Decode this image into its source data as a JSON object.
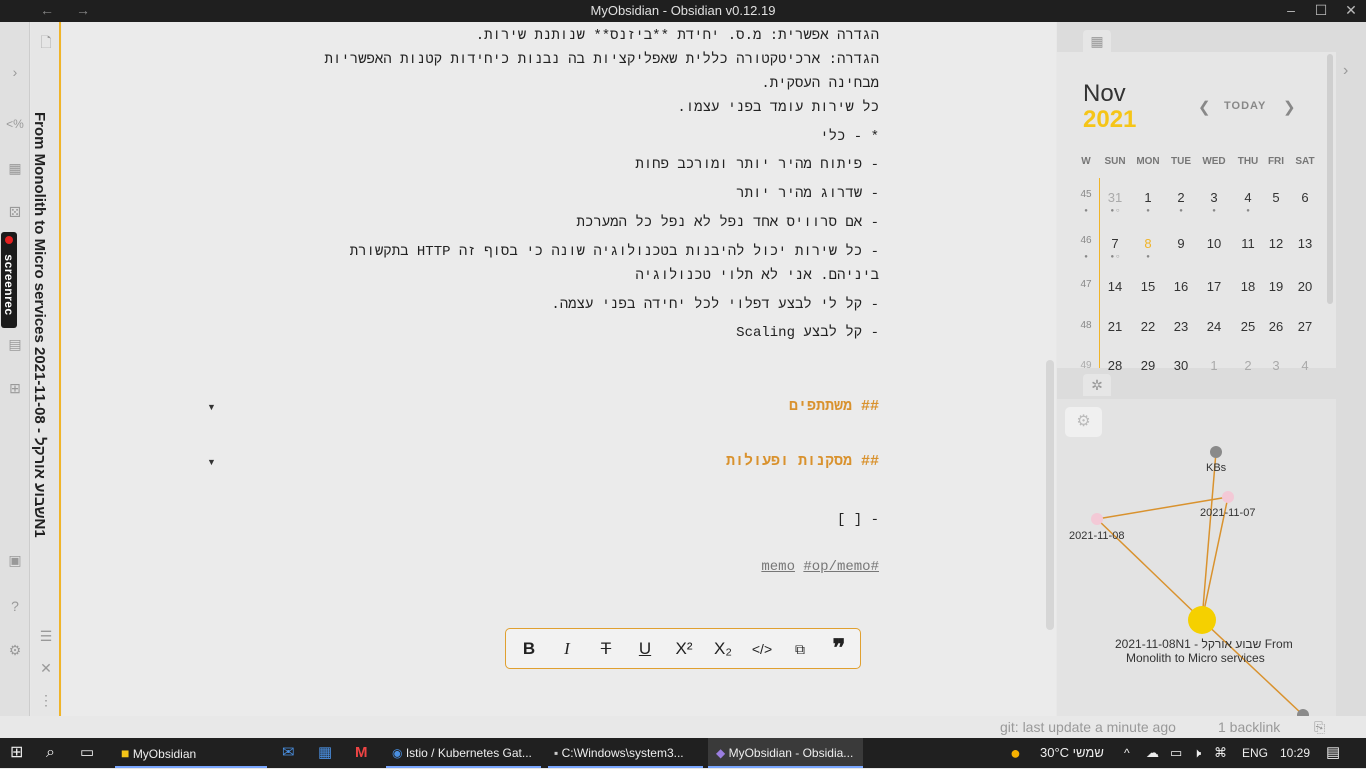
{
  "window": {
    "title": "MyObsidian - Obsidian v0.12.19"
  },
  "note": {
    "vertical_title": "From Monolith to Micro services שבוע אורקל - 2021-11-08N1"
  },
  "editor": {
    "lines": [
      "הגדרה אפשרית: מ.ס. יחידת **ביזנס** שנותנת שירות.",
      "הגדרה: ארכיטקטורה כללית שאפליקציות בה נבנות כיחידות קטנות האפשריות",
      "מבחינה העסקית.",
      "כל שירות עומד בפני עצמו.",
      "*  -  כלי",
      "- פיתוח מהיר יותר ומורכב פחות",
      "- שדרוג מהיר יותר",
      "- אם סרוויס אחד נפל לא נפל כל המערכת",
      "- כל שירות יכול להיבנות בטכנולוגיה שונה כי בסוף זה HTTP בתקשורת",
      "ביניהם. אני לא תלוי טכנולוגיה",
      "- קל לי לבצע דפלוי לכל יחידה בפני עצמה.",
      "- קל לבצע Scaling"
    ],
    "heading1": "## משתתפים",
    "heading2": "## מסקנות ופעולות",
    "checkbox": "- [ ]",
    "tag_memo": "memo",
    "tag_op": "#op/memo#"
  },
  "format_toolbar": [
    "bold",
    "italic",
    "strikethrough",
    "underline",
    "superscript",
    "subscript",
    "code",
    "codeblock",
    "quote"
  ],
  "calendar": {
    "month": "Nov",
    "year": "2021",
    "today": "TODAY",
    "dow": [
      "W",
      "SUN",
      "MON",
      "TUE",
      "WED",
      "THU",
      "FRI",
      "SAT"
    ],
    "weeks": [
      {
        "w": "45",
        "days": [
          "31",
          "1",
          "2",
          "3",
          "4",
          "5",
          "6"
        ]
      },
      {
        "w": "46",
        "days": [
          "7",
          "8",
          "9",
          "10",
          "11",
          "12",
          "13"
        ]
      },
      {
        "w": "47",
        "days": [
          "14",
          "15",
          "16",
          "17",
          "18",
          "19",
          "20"
        ]
      },
      {
        "w": "48",
        "days": [
          "21",
          "22",
          "23",
          "24",
          "25",
          "26",
          "27"
        ]
      },
      {
        "w": "49",
        "days": [
          "28",
          "29",
          "30",
          "1",
          "2",
          "3",
          "4"
        ]
      }
    ]
  },
  "graph": {
    "nodes": [
      {
        "label": "KBs"
      },
      {
        "label": "2021-11-07"
      },
      {
        "label": "2021-11-08"
      },
      {
        "label": "2021-11-08N1 - שבוע אורקל From"
      },
      {
        "label": "Monolith to Micro services"
      }
    ]
  },
  "status": {
    "git": "git: last update a minute ago",
    "backlinks": "1 backlink"
  },
  "taskbar": {
    "items": [
      "MyObsidian",
      "Istio / Kubernetes Gat...",
      "C:\\Windows\\system3...",
      "MyObsidian - Obsidia..."
    ],
    "weather": "30°C  שמשי",
    "lang": "ENG",
    "time": "10:29"
  }
}
